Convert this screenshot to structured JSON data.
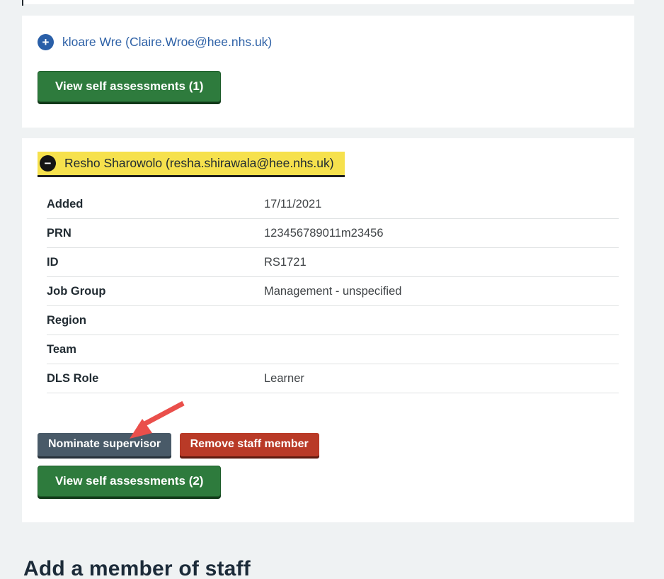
{
  "page": {
    "heading_add_staff": "Add a member of staff",
    "background_color": "#eff2f3"
  },
  "icons": {
    "expand_glyph": "+",
    "collapse_glyph": "−"
  },
  "staff_list": {
    "members": [
      {
        "state": "collapsed",
        "name_link": "kloare Wre (Claire.Wroe@hee.nhs.uk)",
        "view_button_label": "View self assessments (1)"
      },
      {
        "state": "expanded",
        "name_link": "Resho Sharowolo (resha.shirawala@hee.nhs.uk)",
        "details": [
          {
            "label": "Added",
            "value": "17/11/2021"
          },
          {
            "label": "PRN",
            "value": "123456789011m23456"
          },
          {
            "label": "ID",
            "value": "RS1721"
          },
          {
            "label": "Job Group",
            "value": "Management - unspecified"
          },
          {
            "label": "Region",
            "value": ""
          },
          {
            "label": "Team",
            "value": ""
          },
          {
            "label": "DLS Role",
            "value": "Learner"
          }
        ],
        "buttons": {
          "nominate_supervisor": "Nominate supervisor",
          "remove_staff_member": "Remove staff member",
          "view_self_assessments": "View self assessments (2)"
        }
      }
    ]
  },
  "colors": {
    "link_blue": "#2f62a7",
    "toggle_blue": "#2a5fa8",
    "highlight_yellow": "#f6e14d",
    "button_green": "#2e7b3d",
    "button_slate": "#495a68",
    "button_red": "#b93a27",
    "annotation_arrow_red": "#ea4f4b"
  }
}
